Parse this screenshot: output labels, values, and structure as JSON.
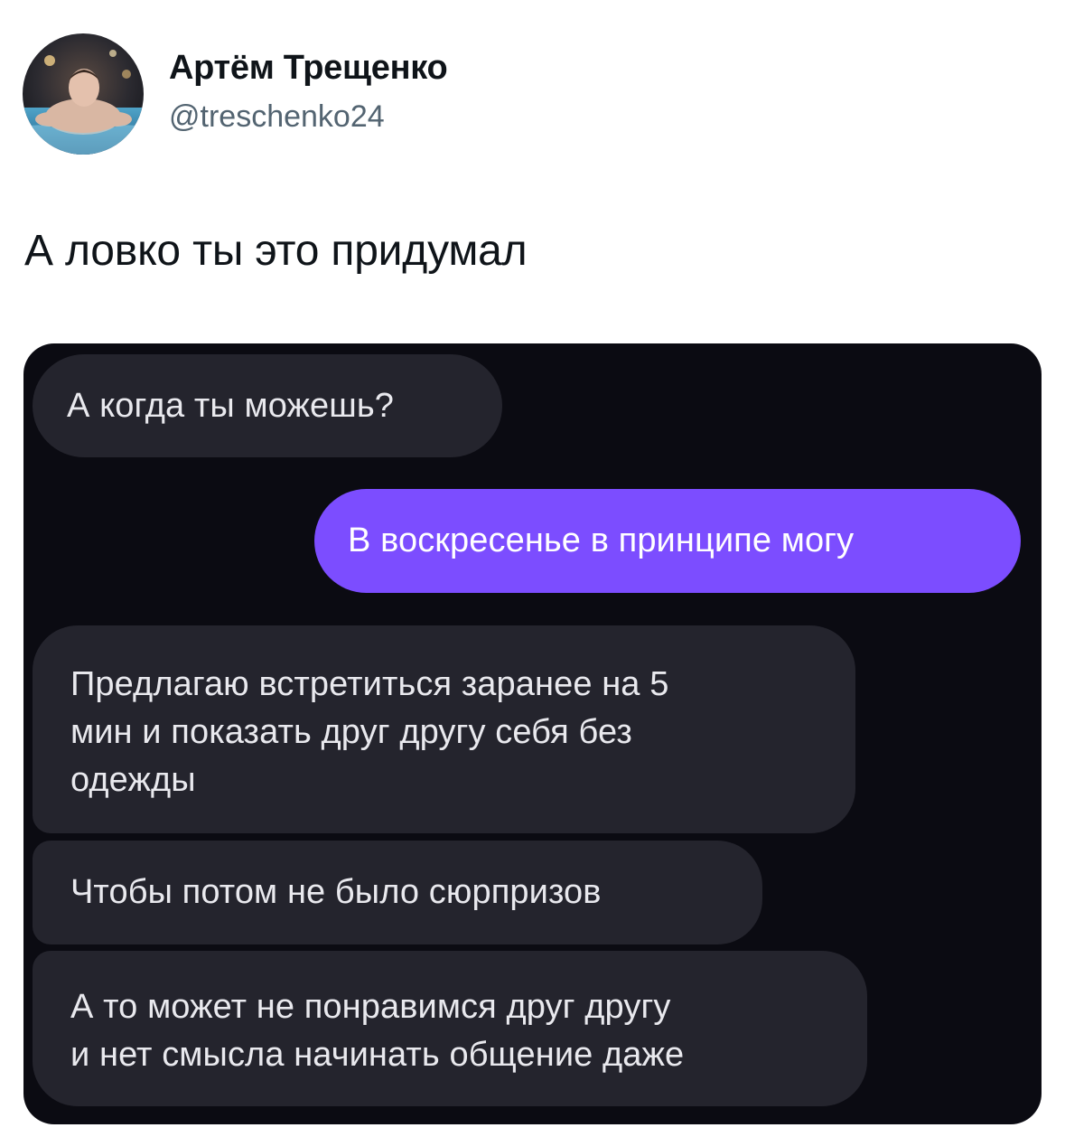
{
  "author": {
    "name": "Артём Трещенко",
    "handle": "@treschenko24",
    "avatar_icon": "profile-photo-avatar"
  },
  "tweet": {
    "text": "А ловко ты это придумал"
  },
  "chat": {
    "background": "#0b0b12",
    "incoming_color": "#24242d",
    "outgoing_color": "#7c4dff",
    "messages": [
      {
        "direction": "incoming",
        "lines": [
          "А когда ты можешь?"
        ]
      },
      {
        "direction": "outgoing",
        "lines": [
          "В воскресенье в принципе могу"
        ]
      },
      {
        "direction": "incoming",
        "lines": [
          "Предлагаю встретиться заранее на 5",
          "мин и показать друг другу себя без",
          "одежды"
        ]
      },
      {
        "direction": "incoming",
        "lines": [
          "Чтобы потом не было сюрпризов"
        ]
      },
      {
        "direction": "incoming",
        "lines": [
          "А то может не понравимся друг другу",
          "и нет смысла начинать общение даже"
        ]
      }
    ]
  }
}
